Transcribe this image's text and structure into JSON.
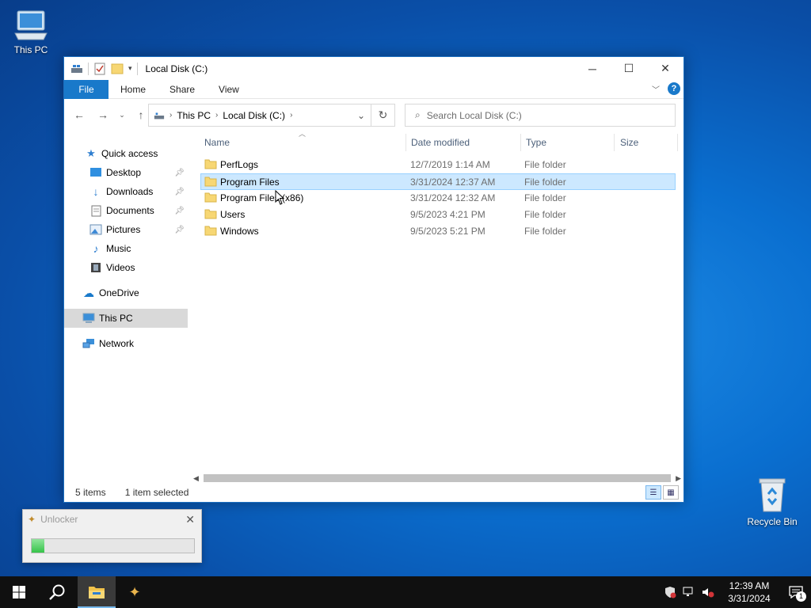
{
  "desktop": {
    "icons": [
      {
        "label": "This PC"
      },
      {
        "label": "Recycle Bin"
      }
    ]
  },
  "explorer": {
    "title": "Local Disk (C:)",
    "ribbon_tabs": [
      "File",
      "Home",
      "Share",
      "View"
    ],
    "address": {
      "crumbs": [
        "This PC",
        "Local Disk (C:)"
      ]
    },
    "search": {
      "placeholder": "Search Local Disk (C:)"
    },
    "nav": {
      "quick_access": "Quick access",
      "quick_items": [
        {
          "label": "Desktop",
          "pinned": true
        },
        {
          "label": "Downloads",
          "pinned": true
        },
        {
          "label": "Documents",
          "pinned": true
        },
        {
          "label": "Pictures",
          "pinned": true
        },
        {
          "label": "Music",
          "pinned": false
        },
        {
          "label": "Videos",
          "pinned": false
        }
      ],
      "onedrive": "OneDrive",
      "this_pc": "This PC",
      "network": "Network"
    },
    "columns": [
      "Name",
      "Date modified",
      "Type",
      "Size"
    ],
    "files": [
      {
        "name": "PerfLogs",
        "date": "12/7/2019 1:14 AM",
        "type": "File folder"
      },
      {
        "name": "Program Files",
        "date": "3/31/2024 12:37 AM",
        "type": "File folder",
        "selected": true
      },
      {
        "name": "Program Files (x86)",
        "date": "3/31/2024 12:32 AM",
        "type": "File folder"
      },
      {
        "name": "Users",
        "date": "9/5/2023 4:21 PM",
        "type": "File folder"
      },
      {
        "name": "Windows",
        "date": "9/5/2023 5:21 PM",
        "type": "File folder"
      }
    ],
    "status": {
      "count": "5 items",
      "selected": "1 item selected"
    }
  },
  "unlocker": {
    "title": "Unlocker",
    "progress": 0.08
  },
  "taskbar": {
    "clock_time": "12:39 AM",
    "clock_date": "3/31/2024",
    "notification_count": "1"
  },
  "colors": {
    "accent": "#1979ca",
    "selection": "#cce8ff",
    "taskbar": "#101010"
  }
}
